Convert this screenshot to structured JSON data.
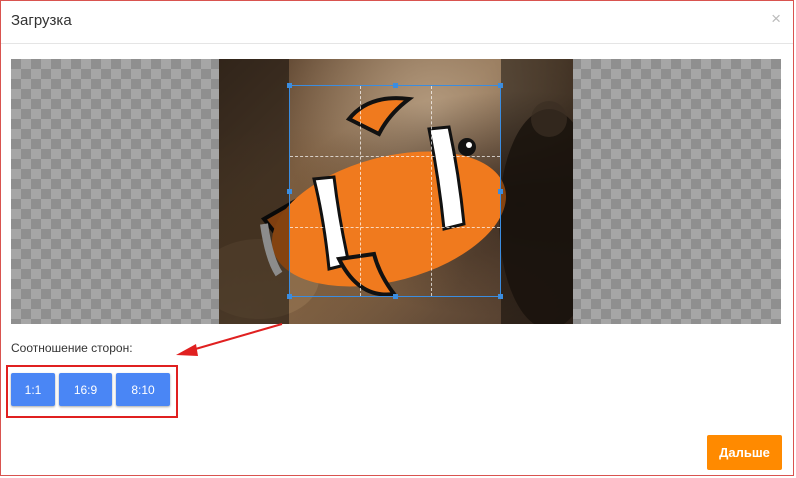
{
  "modal": {
    "title": "Загрузка",
    "close_symbol": "×"
  },
  "editor": {
    "image_subject": "clownfish photo",
    "crop_ratio_label": "Соотношение сторон:",
    "ratio_buttons": [
      {
        "label": "1:1"
      },
      {
        "label": "16:9"
      },
      {
        "label": "8:10"
      }
    ]
  },
  "footer": {
    "next_label": "Дальше"
  },
  "colors": {
    "accent_blue": "#4a86f5",
    "next_orange": "#ff8a00",
    "highlight_red": "#e02020",
    "crop_border": "#3b8de0"
  },
  "icons": {
    "close": "close-icon",
    "annotation": "arrow-annotation"
  }
}
